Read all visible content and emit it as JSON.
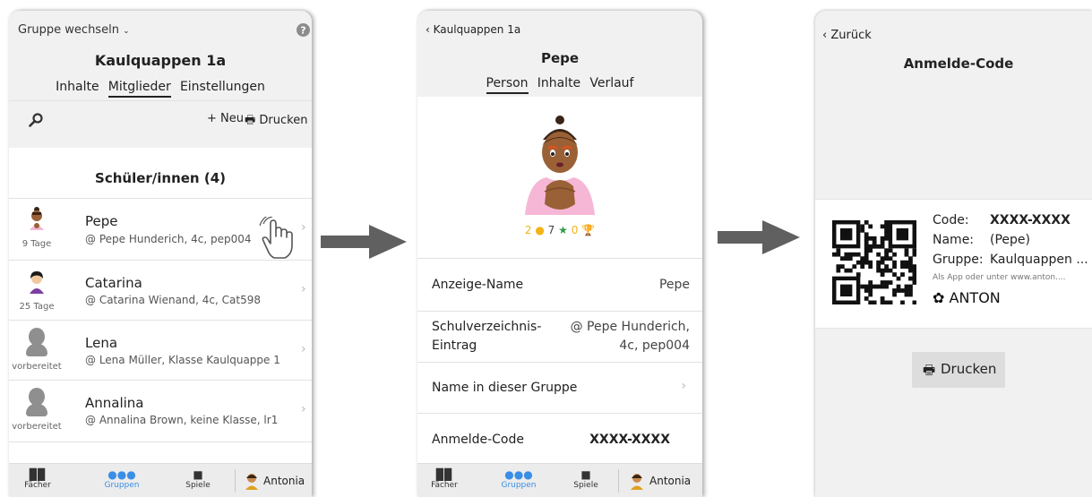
{
  "screen1": {
    "group_switch": "Gruppe wechseln",
    "title": "Kaulquappen 1a",
    "tabs": [
      "Inhalte",
      "Mitglieder",
      "Einstellungen"
    ],
    "active_tab": "Mitglieder",
    "new_label": "Neu",
    "print_label": "Drucken",
    "section_title": "Schüler/innen (4)",
    "students": [
      {
        "name": "Pepe",
        "sub": "@ Pepe Hunderich, 4c, pep004",
        "age": "9 Tage"
      },
      {
        "name": "Catarina",
        "sub": "@ Catarina Wienand, 4c, Cat598",
        "age": "25 Tage"
      },
      {
        "name": "Lena",
        "sub": "@ Lena Müller, Klasse Kaulquappe 1",
        "age": "vorbereitet"
      },
      {
        "name": "Annalina",
        "sub": "@ Annalina Brown, keine Klasse, lr1",
        "age": "vorbereitet"
      }
    ],
    "nav": [
      "Fächer",
      "Gruppen",
      "Spiele"
    ],
    "user": "Antonia"
  },
  "screen2": {
    "back": "Kaulquappen 1a",
    "title": "Pepe",
    "tabs": [
      "Person",
      "Inhalte",
      "Verlauf"
    ],
    "active_tab": "Person",
    "stats": {
      "coins": "2",
      "stars": "7",
      "trophies": "0"
    },
    "fields": {
      "display_name_label": "Anzeige-Name",
      "display_name_value": "Pepe",
      "directory_label_1": "Schulverzeichnis-",
      "directory_label_2": "Eintrag",
      "directory_value_1": "@ Pepe Hunderich,",
      "directory_value_2": "4c, pep004",
      "group_name_label": "Name in dieser Gruppe",
      "code_label": "Anmelde-Code",
      "code_value": "XXXX-XXXX"
    },
    "nav": [
      "Fächer",
      "Gruppen",
      "Spiele"
    ],
    "user": "Antonia"
  },
  "screen3": {
    "back": "Zurück",
    "title": "Anmelde-Code",
    "code_key": "Code:",
    "code_value": "XXXX-XXXX",
    "name_key": "Name:",
    "name_value": "(Pepe)",
    "group_key": "Gruppe:",
    "group_value": "Kaulquappen ...",
    "hint": "Als App oder unter www.anton....",
    "brand": "ANTON",
    "print_label": "Drucken"
  },
  "colors": {
    "accent_blue": "#3a8ee6",
    "coin": "#f2b416",
    "star": "#2f9a4a",
    "trophy": "#f2b416",
    "arrow": "#606060"
  }
}
